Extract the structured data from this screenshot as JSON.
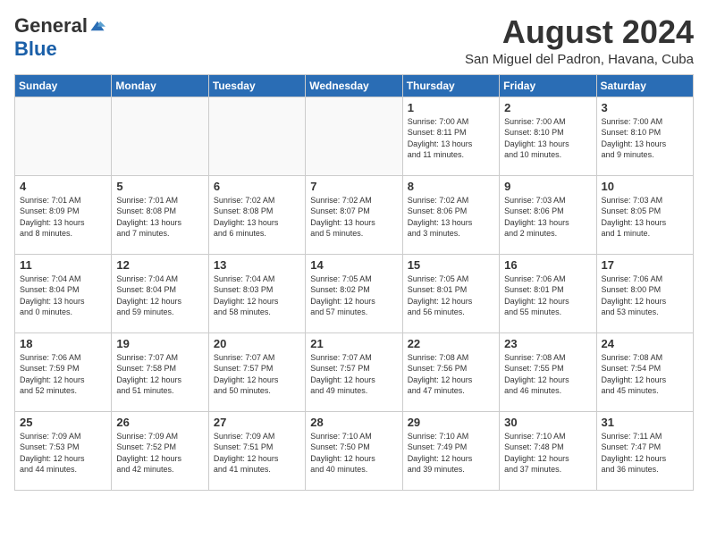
{
  "header": {
    "logo_general": "General",
    "logo_blue": "Blue",
    "month_title": "August 2024",
    "location": "San Miguel del Padron, Havana, Cuba"
  },
  "days_of_week": [
    "Sunday",
    "Monday",
    "Tuesday",
    "Wednesday",
    "Thursday",
    "Friday",
    "Saturday"
  ],
  "weeks": [
    [
      {
        "day": "",
        "info": ""
      },
      {
        "day": "",
        "info": ""
      },
      {
        "day": "",
        "info": ""
      },
      {
        "day": "",
        "info": ""
      },
      {
        "day": "1",
        "info": "Sunrise: 7:00 AM\nSunset: 8:11 PM\nDaylight: 13 hours\nand 11 minutes."
      },
      {
        "day": "2",
        "info": "Sunrise: 7:00 AM\nSunset: 8:10 PM\nDaylight: 13 hours\nand 10 minutes."
      },
      {
        "day": "3",
        "info": "Sunrise: 7:00 AM\nSunset: 8:10 PM\nDaylight: 13 hours\nand 9 minutes."
      }
    ],
    [
      {
        "day": "4",
        "info": "Sunrise: 7:01 AM\nSunset: 8:09 PM\nDaylight: 13 hours\nand 8 minutes."
      },
      {
        "day": "5",
        "info": "Sunrise: 7:01 AM\nSunset: 8:08 PM\nDaylight: 13 hours\nand 7 minutes."
      },
      {
        "day": "6",
        "info": "Sunrise: 7:02 AM\nSunset: 8:08 PM\nDaylight: 13 hours\nand 6 minutes."
      },
      {
        "day": "7",
        "info": "Sunrise: 7:02 AM\nSunset: 8:07 PM\nDaylight: 13 hours\nand 5 minutes."
      },
      {
        "day": "8",
        "info": "Sunrise: 7:02 AM\nSunset: 8:06 PM\nDaylight: 13 hours\nand 3 minutes."
      },
      {
        "day": "9",
        "info": "Sunrise: 7:03 AM\nSunset: 8:06 PM\nDaylight: 13 hours\nand 2 minutes."
      },
      {
        "day": "10",
        "info": "Sunrise: 7:03 AM\nSunset: 8:05 PM\nDaylight: 13 hours\nand 1 minute."
      }
    ],
    [
      {
        "day": "11",
        "info": "Sunrise: 7:04 AM\nSunset: 8:04 PM\nDaylight: 13 hours\nand 0 minutes."
      },
      {
        "day": "12",
        "info": "Sunrise: 7:04 AM\nSunset: 8:04 PM\nDaylight: 12 hours\nand 59 minutes."
      },
      {
        "day": "13",
        "info": "Sunrise: 7:04 AM\nSunset: 8:03 PM\nDaylight: 12 hours\nand 58 minutes."
      },
      {
        "day": "14",
        "info": "Sunrise: 7:05 AM\nSunset: 8:02 PM\nDaylight: 12 hours\nand 57 minutes."
      },
      {
        "day": "15",
        "info": "Sunrise: 7:05 AM\nSunset: 8:01 PM\nDaylight: 12 hours\nand 56 minutes."
      },
      {
        "day": "16",
        "info": "Sunrise: 7:06 AM\nSunset: 8:01 PM\nDaylight: 12 hours\nand 55 minutes."
      },
      {
        "day": "17",
        "info": "Sunrise: 7:06 AM\nSunset: 8:00 PM\nDaylight: 12 hours\nand 53 minutes."
      }
    ],
    [
      {
        "day": "18",
        "info": "Sunrise: 7:06 AM\nSunset: 7:59 PM\nDaylight: 12 hours\nand 52 minutes."
      },
      {
        "day": "19",
        "info": "Sunrise: 7:07 AM\nSunset: 7:58 PM\nDaylight: 12 hours\nand 51 minutes."
      },
      {
        "day": "20",
        "info": "Sunrise: 7:07 AM\nSunset: 7:57 PM\nDaylight: 12 hours\nand 50 minutes."
      },
      {
        "day": "21",
        "info": "Sunrise: 7:07 AM\nSunset: 7:57 PM\nDaylight: 12 hours\nand 49 minutes."
      },
      {
        "day": "22",
        "info": "Sunrise: 7:08 AM\nSunset: 7:56 PM\nDaylight: 12 hours\nand 47 minutes."
      },
      {
        "day": "23",
        "info": "Sunrise: 7:08 AM\nSunset: 7:55 PM\nDaylight: 12 hours\nand 46 minutes."
      },
      {
        "day": "24",
        "info": "Sunrise: 7:08 AM\nSunset: 7:54 PM\nDaylight: 12 hours\nand 45 minutes."
      }
    ],
    [
      {
        "day": "25",
        "info": "Sunrise: 7:09 AM\nSunset: 7:53 PM\nDaylight: 12 hours\nand 44 minutes."
      },
      {
        "day": "26",
        "info": "Sunrise: 7:09 AM\nSunset: 7:52 PM\nDaylight: 12 hours\nand 42 minutes."
      },
      {
        "day": "27",
        "info": "Sunrise: 7:09 AM\nSunset: 7:51 PM\nDaylight: 12 hours\nand 41 minutes."
      },
      {
        "day": "28",
        "info": "Sunrise: 7:10 AM\nSunset: 7:50 PM\nDaylight: 12 hours\nand 40 minutes."
      },
      {
        "day": "29",
        "info": "Sunrise: 7:10 AM\nSunset: 7:49 PM\nDaylight: 12 hours\nand 39 minutes."
      },
      {
        "day": "30",
        "info": "Sunrise: 7:10 AM\nSunset: 7:48 PM\nDaylight: 12 hours\nand 37 minutes."
      },
      {
        "day": "31",
        "info": "Sunrise: 7:11 AM\nSunset: 7:47 PM\nDaylight: 12 hours\nand 36 minutes."
      }
    ]
  ]
}
